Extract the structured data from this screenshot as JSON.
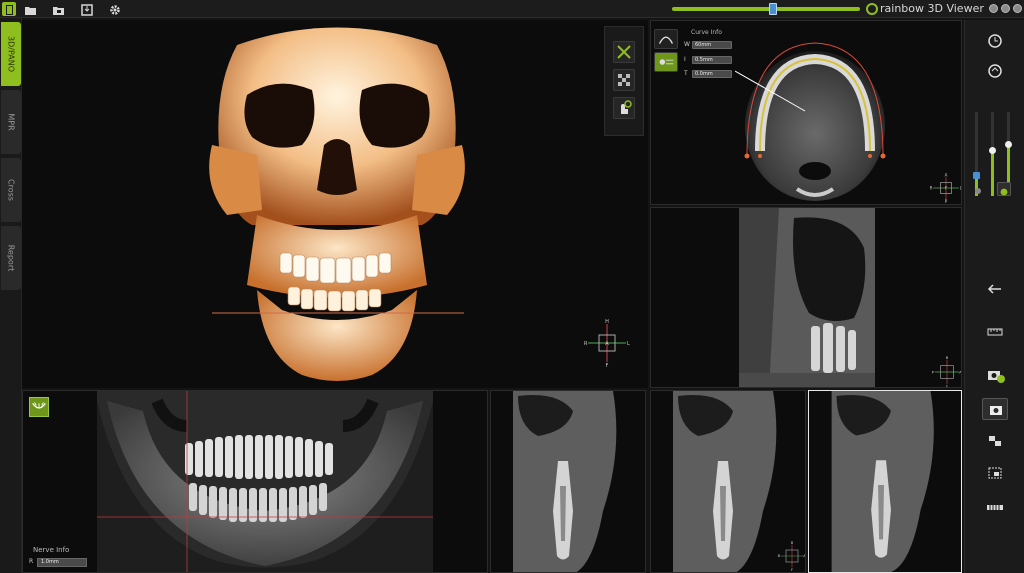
{
  "app": {
    "brand": "rainbow 3D Viewer"
  },
  "colors": {
    "accent": "#8fbf1e",
    "bone": "#f2b272",
    "panel": "#0c0c0c"
  },
  "tabs": [
    {
      "label": "3D/PANO",
      "active": true
    },
    {
      "label": "MPR",
      "active": false
    },
    {
      "label": "Cross",
      "active": false
    },
    {
      "label": "Report",
      "active": false
    }
  ],
  "toolbar_icons": [
    "folder-open-icon",
    "folder-save-icon",
    "export-icon",
    "settings-icon"
  ],
  "viewer3d": {
    "tools": [
      "measure-icon",
      "checker-icon",
      "rotate-hand-icon"
    ],
    "orientation": {
      "top": "H",
      "left": "R",
      "right": "L",
      "bottom": "F",
      "center": "A"
    }
  },
  "curve_panel": {
    "title": "Curve Info",
    "rows": [
      {
        "key": "W",
        "value": "60mm"
      },
      {
        "key": "I",
        "value": "0.5mm"
      },
      {
        "key": "T",
        "value": "0.0mm"
      }
    ],
    "orientation": {
      "top": "A",
      "left": "R",
      "right": "L",
      "bottom": "P",
      "center": "F"
    }
  },
  "cross_panel": {
    "orientation": {
      "top": "B",
      "left": "P",
      "right": "A",
      "bottom": "F"
    }
  },
  "pano_panel": {
    "nerve_title": "Nerve Info",
    "nerve_key": "R",
    "nerve_value": "1.0mm"
  },
  "slice_panel": {
    "orientation": {
      "top": "B",
      "left": "B",
      "right": "A",
      "bottom": "F"
    }
  },
  "window_level": {
    "level1": 0.25,
    "level2": 0.55,
    "level3": 0.62
  }
}
